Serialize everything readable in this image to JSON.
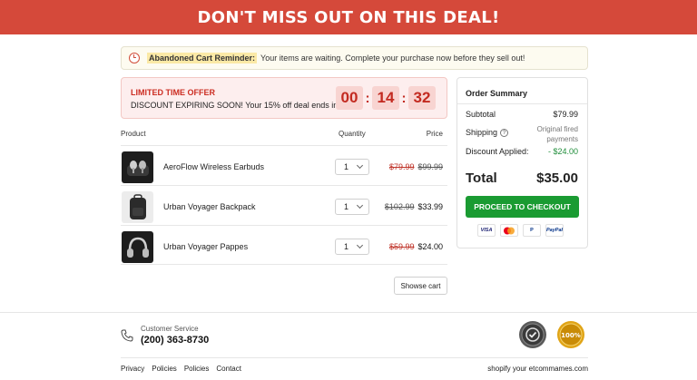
{
  "banner": {
    "text": "DON'T MISS OUT ON THIS DEAL!"
  },
  "reminder": {
    "label": "Abandoned Cart Reminder:",
    "text": "Your items are waiting. Complete your purchase now before they sell out!"
  },
  "offer": {
    "title": "LIMITED TIME OFFER",
    "subtitle": "DISCOUNT EXPIRING SOON! Your 15% off deal ends in:",
    "timer": {
      "hours": "00",
      "minutes": "14",
      "seconds": "32"
    }
  },
  "table": {
    "headers": {
      "product": "Product",
      "quantity": "Quantity",
      "price": "Price"
    },
    "items": [
      {
        "name": "AeroFlow Wireless Earbuds",
        "qty": "1",
        "price_a": "$79.99",
        "price_b": "$99.99"
      },
      {
        "name": "Urban Voyager Backpack",
        "qty": "1",
        "price_a": "$102.99",
        "price_b": "$33.99"
      },
      {
        "name": "Urban Voyager Pappes",
        "qty": "1",
        "price_a": "$59.99",
        "price_b": "$24.00"
      }
    ]
  },
  "show_cart": "Showse cart",
  "summary": {
    "title": "Order Summary",
    "subtotal_label": "Subtotal",
    "subtotal_value": "$79.99",
    "shipping_label": "Shipping",
    "shipping_value": "Original fired payments",
    "discount_label": "Discount Applied:",
    "discount_value": "- $24.00",
    "total_label": "Total",
    "total_value": "$35.00",
    "checkout_label": "PROCEED TO CHECKOUT",
    "payments": [
      "VISA",
      "mastercard",
      "P",
      "PayPal"
    ]
  },
  "footer": {
    "cs_label": "Customer Service",
    "cs_phone": "(200) 363-8730",
    "links": [
      "Privacy",
      "Policies",
      "Policies",
      "Contact"
    ],
    "shopify": "shopify your etcommames.com"
  },
  "colors": {
    "accent": "#d5493a",
    "checkout": "#1a9b32",
    "sale": "#c0352b",
    "discount": "#1f8d3a"
  }
}
